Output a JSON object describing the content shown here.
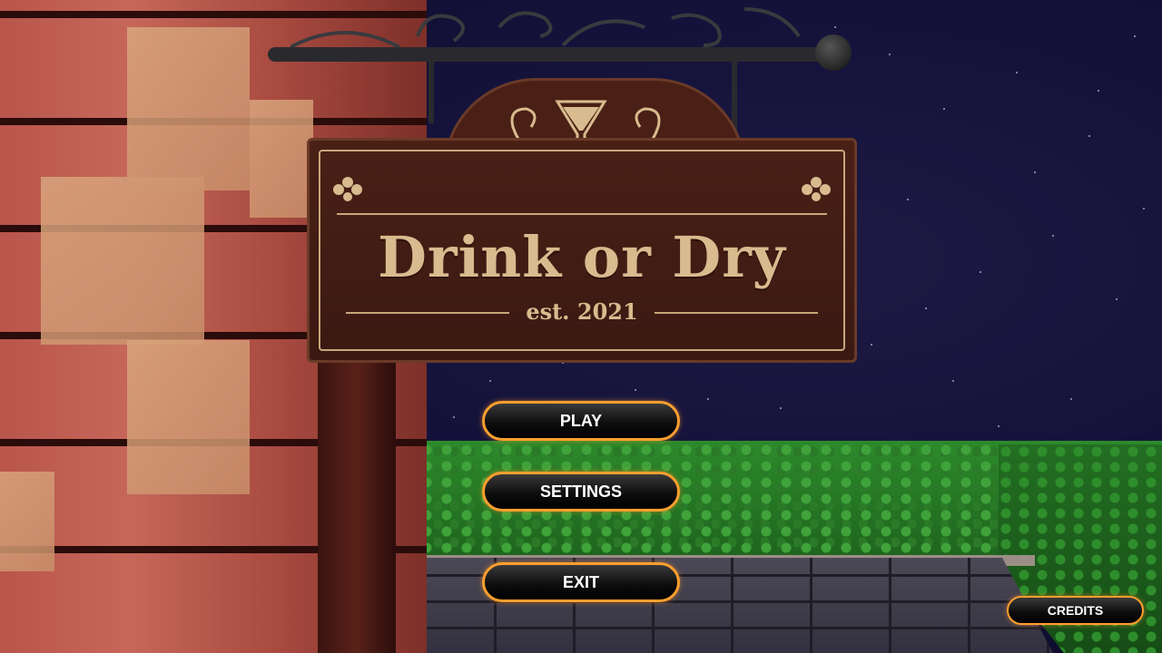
{
  "sign": {
    "title": "Drink or Dry",
    "subtitle": "est. 2021"
  },
  "menu": {
    "play": "PLAY",
    "settings": "SETTINGS",
    "exit": "EXIT",
    "credits": "CREDITS"
  },
  "colors": {
    "button_border": "#ff9f2e",
    "sign_wood": "#4a2016",
    "sign_text": "#d8bb8e"
  }
}
